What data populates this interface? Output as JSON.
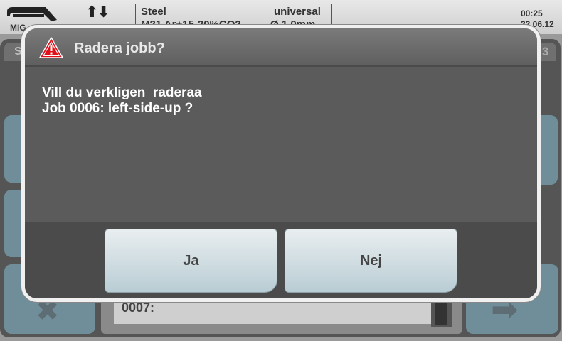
{
  "status_bar": {
    "mode": "MIG",
    "material": "Steel",
    "wire": "universal",
    "gas": "M21 Ar+15-20%CO2",
    "diameter": "Ø 1.0mm",
    "time": "00:25",
    "date": "22.06.12",
    "icons": [
      "welding-torch-icon",
      "up-down-arrows-icon"
    ]
  },
  "background": {
    "tab_left": "S",
    "tab_right": "3",
    "next_job": "0007:",
    "icons": [
      "delete-x-icon",
      "arrow-right-icon"
    ]
  },
  "dialog": {
    "title": "Radera jobb?",
    "icon": "warning-triangle-icon",
    "message_line1": "Vill du verkligen  raderaa",
    "message_line2": "Job 0006: left-side-up ?",
    "yes_label": "Ja",
    "no_label": "Nej",
    "colors": {
      "warning_red": "#e0101a",
      "button_top": "#e9eef0",
      "button_bottom": "#b9cdd4"
    }
  }
}
